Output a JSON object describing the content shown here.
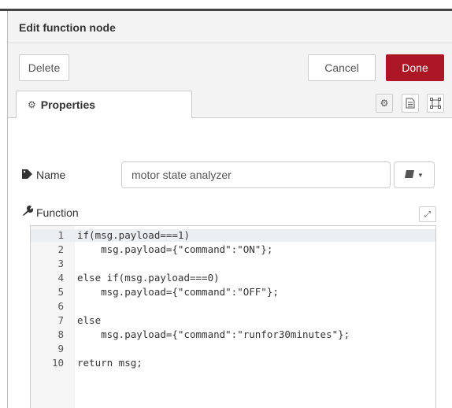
{
  "tray": {
    "title": "Edit function node"
  },
  "toolbar": {
    "delete_label": "Delete",
    "cancel_label": "Cancel",
    "done_label": "Done",
    "done_color": "#ad1625"
  },
  "tabs": {
    "properties_label": "Properties",
    "icons": [
      "gear-icon",
      "description-icon",
      "appearance-icon"
    ]
  },
  "form": {
    "name_label": "Name",
    "name_value": "motor state analyzer",
    "function_label": "Function"
  },
  "editor": {
    "lines": [
      {
        "num": "1",
        "text": "if(msg.payload===1)"
      },
      {
        "num": "2",
        "text": "    msg.payload={\"command\":\"ON\"};"
      },
      {
        "num": "3",
        "text": ""
      },
      {
        "num": "4",
        "text": "else if(msg.payload===0)"
      },
      {
        "num": "5",
        "text": "    msg.payload={\"command\":\"OFF\"};"
      },
      {
        "num": "6",
        "text": ""
      },
      {
        "num": "7",
        "text": "else"
      },
      {
        "num": "8",
        "text": "    msg.payload={\"command\":\"runfor30minutes\"};"
      },
      {
        "num": "9",
        "text": ""
      },
      {
        "num": "10",
        "text": "return msg;"
      }
    ]
  }
}
